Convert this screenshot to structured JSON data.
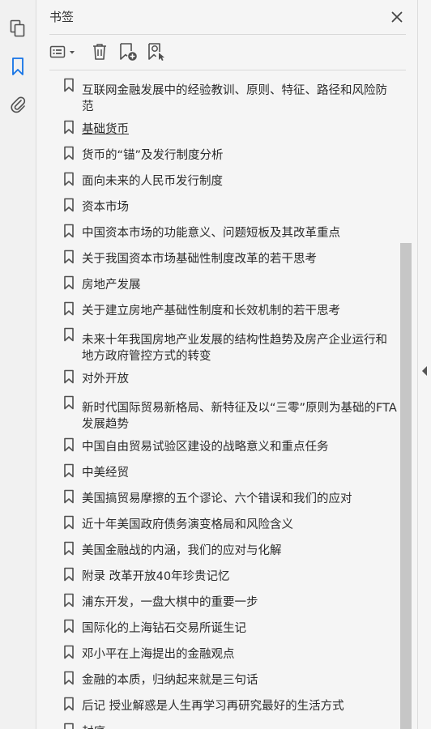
{
  "panel": {
    "title": "书签"
  },
  "colors": {
    "accent": "#1473e6",
    "icon": "#505050"
  },
  "bookmarks": [
    {
      "label": "互联网金融发展中的经验教训、原则、特征、路径和风险防范",
      "lines": 2
    },
    {
      "label": "基础货币",
      "lines": 1,
      "selected": true
    },
    {
      "label": "货币的“锚”及发行制度分析",
      "lines": 1
    },
    {
      "label": "面向未来的人民币发行制度",
      "lines": 1
    },
    {
      "label": "资本市场",
      "lines": 1
    },
    {
      "label": "中国资本市场的功能意义、问题短板及其改革重点",
      "lines": 1
    },
    {
      "label": "关于我国资本市场基础性制度改革的若干思考",
      "lines": 1
    },
    {
      "label": "房地产发展",
      "lines": 1
    },
    {
      "label": "关于建立房地产基础性制度和长效机制的若干思考",
      "lines": 1
    },
    {
      "label": "未来十年我国房地产业发展的结构性趋势及房产企业运行和地方政府管控方式的转变",
      "lines": 2
    },
    {
      "label": "对外开放",
      "lines": 1
    },
    {
      "label": "新时代国际贸易新格局、新特征及以“三零”原则为基础的FTA发展趋势",
      "lines": 2
    },
    {
      "label": "中国自由贸易试验区建设的战略意义和重点任务",
      "lines": 1
    },
    {
      "label": "中美经贸",
      "lines": 1
    },
    {
      "label": "美国搞贸易摩擦的五个谬论、六个错误和我们的应对",
      "lines": 1
    },
    {
      "label": "近十年美国政府债务演变格局和风险含义",
      "lines": 1
    },
    {
      "label": "美国金融战的内涵，我们的应对与化解",
      "lines": 1
    },
    {
      "label": "附录  改革开放40年珍贵记忆",
      "lines": 1
    },
    {
      "label": "浦东开发，一盘大棋中的重要一步",
      "lines": 1
    },
    {
      "label": "国际化的上海钻石交易所诞生记",
      "lines": 1
    },
    {
      "label": "邓小平在上海提出的金融观点",
      "lines": 1
    },
    {
      "label": "金融的本质，归纳起来就是三句话",
      "lines": 1
    },
    {
      "label": "后记  授业解惑是人生再学习再研究最好的生活方式",
      "lines": 1
    },
    {
      "label": "封底",
      "lines": 1
    }
  ]
}
